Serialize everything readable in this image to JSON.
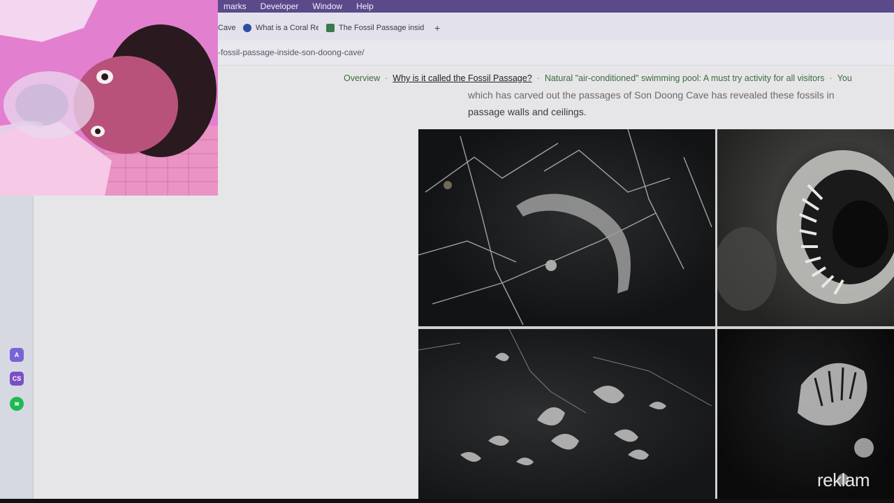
{
  "menubar": {
    "items": [
      "marks",
      "Developer",
      "Window",
      "Help"
    ]
  },
  "tabs": [
    {
      "label": "Cave",
      "favicon_color": "#d07a2a"
    },
    {
      "label": "What is a Coral Re",
      "favicon_color": "#2f4ea0",
      "active": true
    },
    {
      "label": "The Fossil Passage insid",
      "favicon_color": "#3c7a4e"
    }
  ],
  "newtab_label": "+",
  "url": "-fossil-passage-inside-son-doong-cave/",
  "dock": {
    "icons": [
      {
        "name": "app-a-icon",
        "glyph": "A",
        "color": "#7a63d6"
      },
      {
        "name": "cs-icon",
        "glyph": "CS",
        "color": "#7a4fc4"
      },
      {
        "name": "spotify-icon",
        "glyph": "≋",
        "color": "#1db954"
      }
    ]
  },
  "toc": {
    "items": [
      "Overview",
      "Why is it called the Fossil Passage?",
      "Natural \"air-conditioned\" swimming pool: A must try activity for all visitors",
      "You"
    ],
    "current_index": 1,
    "separator": "·"
  },
  "article": {
    "line1": "which has carved out the passages of Son Doong Cave has revealed these fossils in",
    "line2": "passage walls and ceilings."
  },
  "watermark": "reklam"
}
